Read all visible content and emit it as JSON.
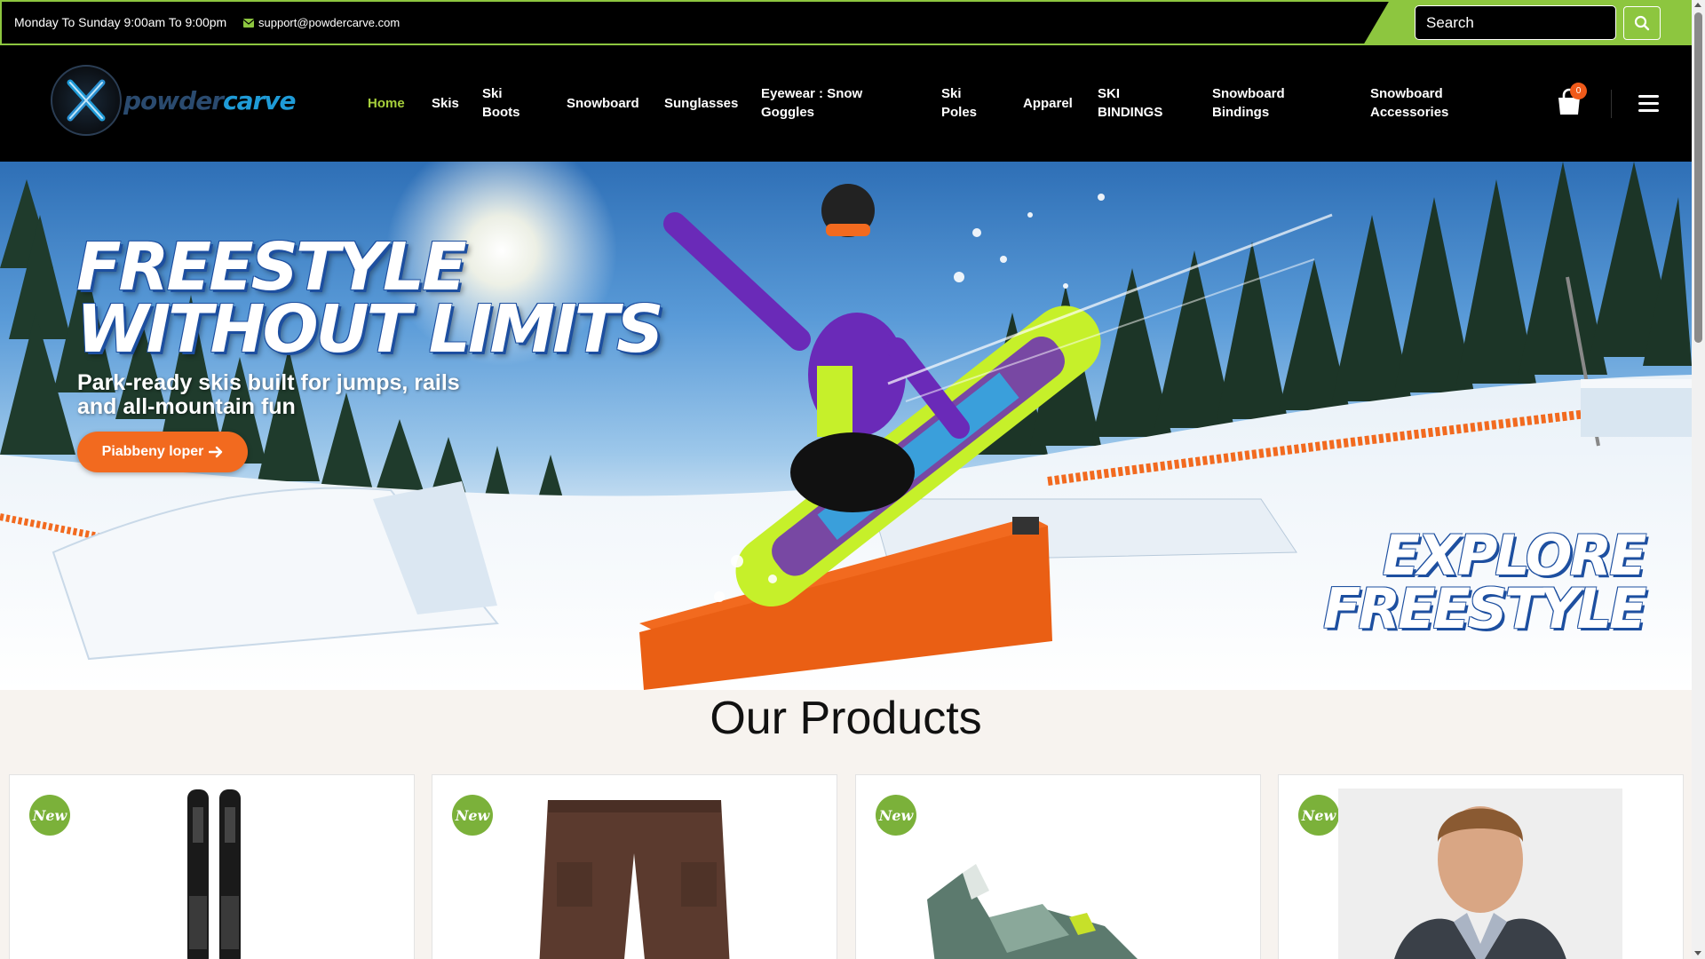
{
  "topbar": {
    "hours": "Monday To Sunday 9:00am To 9:00pm",
    "email": "support@powdercarve.com",
    "email_icon": "envelope-icon",
    "search_placeholder": "Search",
    "search_icon": "search-icon"
  },
  "brand": {
    "name_part1": "powder",
    "name_part2": "carve"
  },
  "nav": {
    "items": [
      {
        "label": "Home",
        "active": true
      },
      {
        "label": "Skis"
      },
      {
        "label": "Ski Boots"
      },
      {
        "label": "Snowboard"
      },
      {
        "label": "Sunglasses"
      },
      {
        "label": "Eyewear : Snow Goggles"
      },
      {
        "label": "Ski Poles"
      },
      {
        "label": "Apparel"
      },
      {
        "label": "SKI BINDINGS"
      },
      {
        "label": "Snowboard Bindings"
      },
      {
        "label": "Snowboard Accessories"
      }
    ],
    "cart_count": "0",
    "cart_icon": "shopping-bag-icon",
    "menu_icon": "hamburger-icon"
  },
  "hero": {
    "title": "FREESTYLE\nWITHOUT LIMITS",
    "subtitle": "Park-ready skis built for jumps, rails and all-mountain fun",
    "button_label": "Pіabbeny loper",
    "cta": "EXPLORE\nFREESTYLE"
  },
  "products": {
    "title": "Our Products",
    "badge": "New",
    "items": [
      {
        "kind": "skis"
      },
      {
        "kind": "cargo-shorts"
      },
      {
        "kind": "ski-boot"
      },
      {
        "kind": "vest-model"
      }
    ]
  },
  "colors": {
    "accent_green": "#8dc63f",
    "orange": "#f26a1f",
    "badge_green": "#7bb13a",
    "active_nav": "#a6cf3b"
  }
}
